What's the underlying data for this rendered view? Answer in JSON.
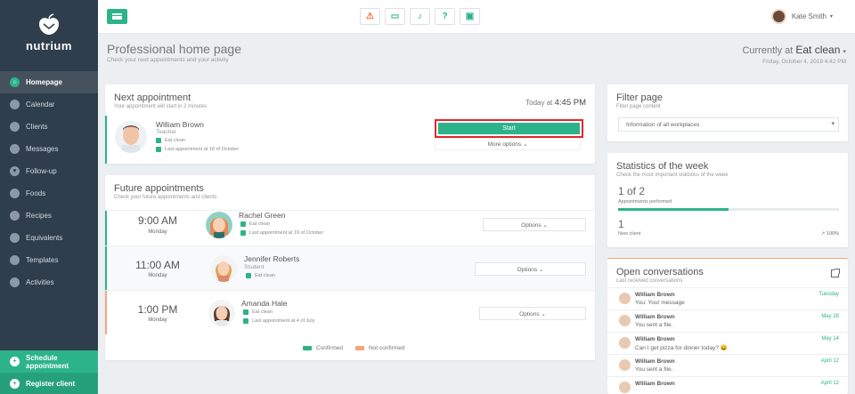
{
  "brand": {
    "name": "nutrium"
  },
  "colors": {
    "accent": "#2db38a",
    "sidebar": "#2e3e4c",
    "unconfirmed": "#f3a77b",
    "highlight": "#e0282e"
  },
  "sidebar": {
    "items": [
      {
        "label": "Homepage",
        "icon": "home-icon",
        "active": true
      },
      {
        "label": "Calendar",
        "icon": "calendar-icon"
      },
      {
        "label": "Clients",
        "icon": "clients-icon"
      },
      {
        "label": "Messages",
        "icon": "messages-icon"
      },
      {
        "label": "Follow-up",
        "icon": "heart-icon"
      },
      {
        "label": "Foods",
        "icon": "food-icon"
      },
      {
        "label": "Recipes",
        "icon": "recipe-icon"
      },
      {
        "label": "Equivalents",
        "icon": "equivalents-icon"
      },
      {
        "label": "Templates",
        "icon": "templates-icon"
      },
      {
        "label": "Activities",
        "icon": "activities-icon"
      }
    ],
    "schedule_label": "Schedule appointment",
    "register_label": "Register client"
  },
  "topbar": {
    "icons": [
      "warning-icon",
      "card-icon",
      "bell-icon",
      "help-icon",
      "briefcase-icon"
    ],
    "user_name": "Kate Smith"
  },
  "header": {
    "title": "Professional home page",
    "subtitle": "Check your next appointments and your activity",
    "current_prefix": "Currently at",
    "current_place": "Eat clean",
    "current_date": "Friday, October 4, 2019 4:42 PM"
  },
  "next": {
    "title": "Next appointment",
    "subtitle": "Your appointment will start in 2 minutes",
    "today_prefix": "Today at",
    "time": "4:45 PM",
    "name": "William Brown",
    "role": "Teacher",
    "place": "Eat clean",
    "last": "Last appointment at 18 of October",
    "start_label": "Start",
    "more_label": "More options ⌄"
  },
  "future": {
    "title": "Future appointments",
    "subtitle": "Check your future appointments and clients",
    "rows": [
      {
        "time": "9:00 AM",
        "day": "Monday",
        "name": "Rachel Green",
        "role": "",
        "place": "Eat clean",
        "last": "Last appointment at 19 of October",
        "options": "Options ⌄",
        "status": "confirmed"
      },
      {
        "time": "11:00 AM",
        "day": "Monday",
        "name": "Jennifer Roberts",
        "role": "Student",
        "place": "Eat clean",
        "last": "",
        "options": "Options ⌄",
        "status": "confirmed"
      },
      {
        "time": "1:00 PM",
        "day": "Monday",
        "name": "Amanda Hale",
        "role": "",
        "place": "Eat clean",
        "last": "Last appointment at 4 of July",
        "options": "Options ⌄",
        "status": "not_confirmed"
      }
    ],
    "legend": {
      "confirmed": "Confirmed",
      "not_confirmed": "Not confirmed"
    }
  },
  "filter": {
    "title": "Filter page",
    "subtitle": "Filter page content",
    "selected": "Information of all workplaces"
  },
  "stats": {
    "title": "Statistics of the week",
    "subtitle": "Check the most important statistics of the week",
    "performed_value": "1 of 2",
    "performed_label": "Appointments performed",
    "performed_fraction": 0.5,
    "new_value": "1",
    "new_label": "New client",
    "change": "↗ 100%"
  },
  "conversations": {
    "title": "Open conversations",
    "subtitle": "Last received conversations",
    "items": [
      {
        "name": "William Brown",
        "message": "You: Your message",
        "date": "Tuesday"
      },
      {
        "name": "William Brown",
        "message": "You sent a file.",
        "date": "May 28"
      },
      {
        "name": "William Brown",
        "message": "Can I get pizza for dinner today? 😄",
        "date": "May 14"
      },
      {
        "name": "William Brown",
        "message": "You sent a file.",
        "date": "April 12"
      },
      {
        "name": "William Brown",
        "message": "",
        "date": "April 12"
      }
    ]
  }
}
